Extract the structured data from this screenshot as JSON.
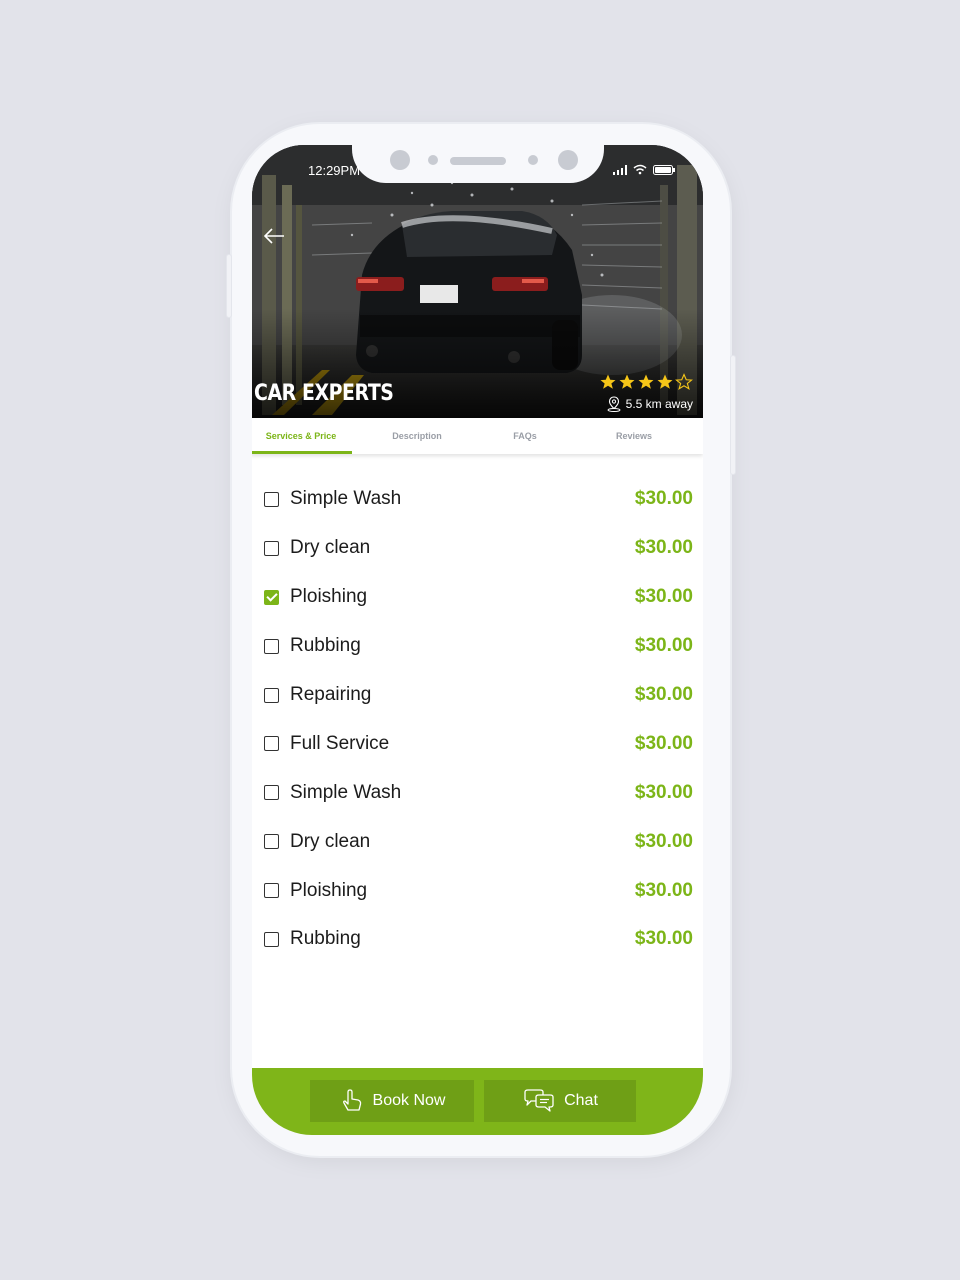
{
  "status_bar": {
    "time": "12:29PM"
  },
  "shop": {
    "name": "CAR EXPERTS",
    "rating": 4,
    "rating_max": 5,
    "distance": "5.5 km away"
  },
  "tabs": [
    {
      "label": "Services & Price",
      "active": true
    },
    {
      "label": "Description",
      "active": false
    },
    {
      "label": "FAQs",
      "active": false
    },
    {
      "label": "Reviews",
      "active": false
    }
  ],
  "services": [
    {
      "name": "Simple Wash",
      "price": "$30.00",
      "checked": false
    },
    {
      "name": "Dry clean",
      "price": "$30.00",
      "checked": false
    },
    {
      "name": "Ploishing",
      "price": "$30.00",
      "checked": true
    },
    {
      "name": "Rubbing",
      "price": "$30.00",
      "checked": false
    },
    {
      "name": "Repairing",
      "price": "$30.00",
      "checked": false
    },
    {
      "name": "Full Service",
      "price": "$30.00",
      "checked": false
    },
    {
      "name": "Simple Wash",
      "price": "$30.00",
      "checked": false
    },
    {
      "name": "Dry clean",
      "price": "$30.00",
      "checked": false
    },
    {
      "name": "Ploishing",
      "price": "$30.00",
      "checked": false
    },
    {
      "name": "Rubbing",
      "price": "$30.00",
      "checked": false
    }
  ],
  "actions": {
    "book_label": "Book Now",
    "chat_label": "Chat"
  },
  "colors": {
    "accent": "#7cb518",
    "button": "#6f9f16",
    "star": "#f5c518"
  },
  "icons": {
    "back": "back-arrow-icon",
    "location": "location-pin-icon",
    "book": "hand-tap-icon",
    "chat": "chat-bubbles-icon"
  }
}
